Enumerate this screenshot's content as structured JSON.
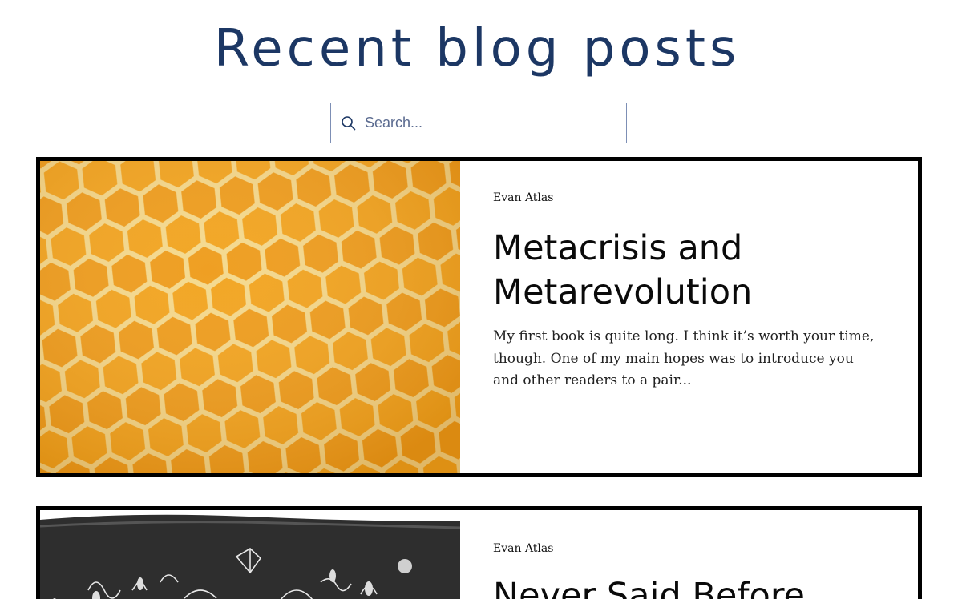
{
  "header": {
    "title": "Recent blog posts"
  },
  "search": {
    "placeholder": "Search...",
    "value": "",
    "icon": "search-icon"
  },
  "posts": [
    {
      "author": "Evan Atlas",
      "title": "Metacrisis and Metarevolution",
      "excerpt": "My first book is quite long. I think it’s worth your time, though. One of my main hopes was to introduce you and other readers to a pair...",
      "image": "honeycomb"
    },
    {
      "author": "Evan Atlas",
      "title": "Never Said Before",
      "excerpt": "",
      "image": "chalkboard-drawing"
    }
  ],
  "colors": {
    "title": "#1c3764",
    "search_border": "#7d8fb5",
    "card_border": "#000000",
    "honey": "#f0a21c"
  }
}
